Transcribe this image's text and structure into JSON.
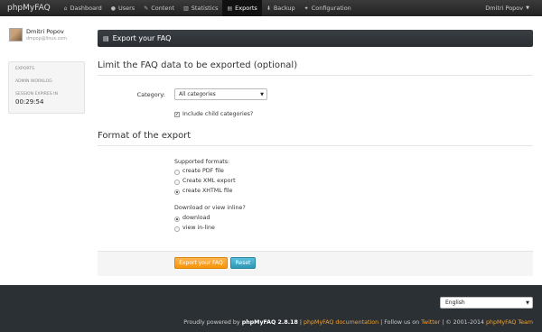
{
  "navbar": {
    "brand": "phpMyFAQ",
    "items": [
      {
        "label": "Dashboard",
        "icon": "home-icon"
      },
      {
        "label": "Users",
        "icon": "user-icon"
      },
      {
        "label": "Content",
        "icon": "pencil-icon"
      },
      {
        "label": "Statistics",
        "icon": "chart-icon"
      },
      {
        "label": "Exports",
        "icon": "book-icon",
        "active": true
      },
      {
        "label": "Backup",
        "icon": "download-icon"
      },
      {
        "label": "Configuration",
        "icon": "wrench-icon"
      }
    ],
    "user_menu": "Dmitri Popov"
  },
  "sidebar": {
    "user_name": "Dmitri Popov",
    "user_email": "dmpop@linux.com",
    "items": [
      "EXPORTS",
      "ADMIN WORKLOG",
      "SESSION EXPIRES IN"
    ],
    "session_timer": "00:29:54"
  },
  "main": {
    "page_title": "Export your FAQ",
    "section1_title": "Limit the FAQ data to be exported (optional)",
    "category_label": "Category:",
    "category_value": "All categories",
    "include_children_label": "Include child categories?",
    "include_children_checked": true,
    "section2_title": "Format of the export",
    "formats_heading": "Supported formats:",
    "formats": [
      {
        "label": "create PDF file",
        "selected": false
      },
      {
        "label": "Create XML export",
        "selected": false
      },
      {
        "label": "create XHTML file",
        "selected": true
      }
    ],
    "download_heading": "Download or view inline?",
    "download_options": [
      {
        "label": "download",
        "selected": true
      },
      {
        "label": "view in-line",
        "selected": false
      }
    ],
    "export_button": "Export your FAQ",
    "reset_button": "Reset"
  },
  "footer": {
    "language": "English",
    "powered_prefix": "Proudly powered by",
    "powered_product": "phpMyFAQ 2.8.18",
    "sep1": "|",
    "docs_link": "phpMyFAQ documentation",
    "sep2": "| Follow us on",
    "twitter_link": "Twitter",
    "copyright": "| © 2001-2014",
    "team_link": "phpMyFAQ Team"
  },
  "colors": {
    "accent": "#f89406",
    "info": "#2f96b4",
    "navbar": "#2a2a2a",
    "footer": "#2b3035"
  }
}
